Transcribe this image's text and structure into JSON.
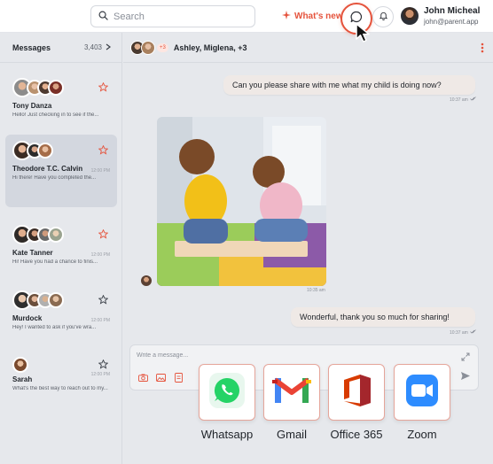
{
  "topbar": {
    "search_placeholder": "Search",
    "whats_new": "What's new",
    "user": {
      "name": "John Micheal",
      "email": "john@parent.app"
    }
  },
  "sidebar": {
    "title": "Messages",
    "count": "3,403",
    "conversations": [
      {
        "name": "Tony Danza",
        "preview": "Hello! Just checking in to see if the...",
        "time": "",
        "starred": true
      },
      {
        "name": "Theodore T.C. Calvin",
        "preview": "Hi there! Have you completed the...",
        "time": "12:00 PM",
        "starred": true
      },
      {
        "name": "Kate Tanner",
        "preview": "Hi! Have you had a chance to finis...",
        "time": "12:00 PM",
        "starred": true
      },
      {
        "name": "Murdock",
        "preview": "Hey! I wanted to ask if you've wra...",
        "time": "12:00 PM",
        "starred": false
      },
      {
        "name": "Sarah",
        "preview": "What's the best way to reach out to my...",
        "time": "12:00 PM",
        "starred": false
      }
    ]
  },
  "chat": {
    "more_count": "+3",
    "title": "Ashley, Miglena, +3",
    "messages": [
      {
        "text": "Can you please share with me what my child is doing now?",
        "time": "10:37 am"
      },
      {
        "time": "10:35 am"
      },
      {
        "text": "Wonderful, thank you so much for sharing!",
        "time": "10:37 am"
      }
    ]
  },
  "composer": {
    "placeholder": "Write a message..."
  },
  "share_options": [
    {
      "label": "Whatsapp",
      "icon": "whatsapp-icon"
    },
    {
      "label": "Gmail",
      "icon": "gmail-icon"
    },
    {
      "label": "Office 365",
      "icon": "office-365-icon"
    },
    {
      "label": "Zoom",
      "icon": "zoom-icon"
    }
  ],
  "colors": {
    "accent": "#e5533c",
    "bubble": "#efe9e6",
    "background": "#e6e8ec"
  }
}
